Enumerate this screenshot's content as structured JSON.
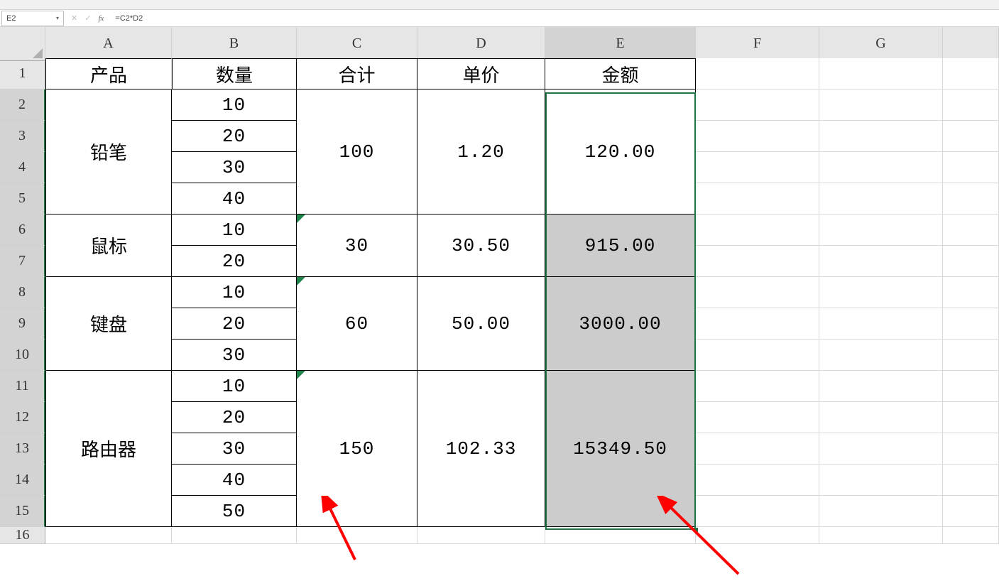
{
  "nameBox": "E2",
  "formula": "=C2*D2",
  "columns": [
    "A",
    "B",
    "C",
    "D",
    "E",
    "F",
    "G",
    ""
  ],
  "rows": [
    "1",
    "2",
    "3",
    "4",
    "5",
    "6",
    "7",
    "8",
    "9",
    "10",
    "11",
    "12",
    "13",
    "14",
    "15",
    "16"
  ],
  "hdr": {
    "A": "产品",
    "B": "数量",
    "C": "合计",
    "D": "单价",
    "E": "金额"
  },
  "colB": {
    "r2": "10",
    "r3": "20",
    "r4": "30",
    "r5": "40",
    "r6": "10",
    "r7": "20",
    "r8": "10",
    "r9": "20",
    "r10": "30",
    "r11": "10",
    "r12": "20",
    "r13": "30",
    "r14": "40",
    "r15": "50"
  },
  "colA": {
    "g1": "铅笔",
    "g2": "鼠标",
    "g3": "键盘",
    "g4": "路由器"
  },
  "colC": {
    "g1": "100",
    "g2": "30",
    "g3": "60",
    "g4": "150"
  },
  "colD": {
    "g1": "1.20",
    "g2": "30.50",
    "g3": "50.00",
    "g4": "102.33"
  },
  "colE": {
    "g1": "120.00",
    "g2": "915.00",
    "g3": "3000.00",
    "g4": "15349.50"
  },
  "icons": {
    "cancel": "✕",
    "enter": "✓",
    "fx": "fx",
    "dd": "▾"
  }
}
